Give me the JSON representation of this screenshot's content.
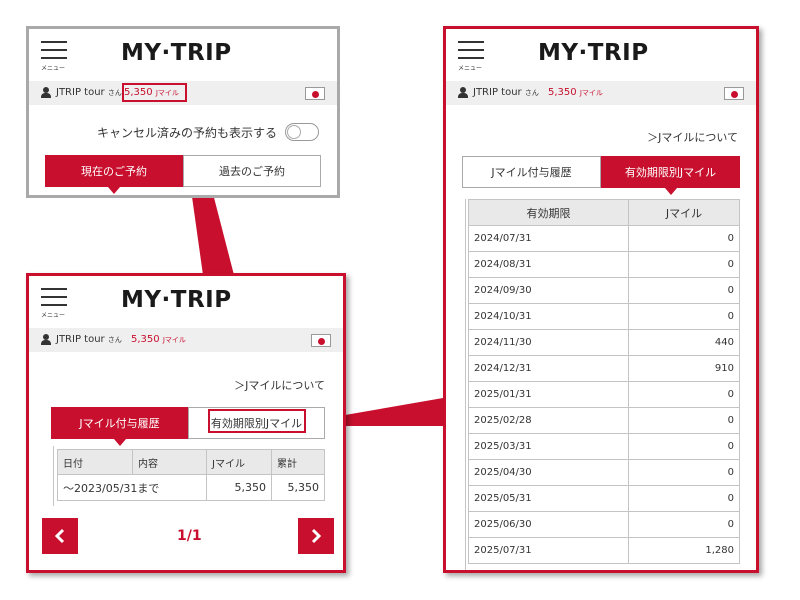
{
  "app": {
    "logo": "MY·TRIP",
    "menu_label": "メニュー"
  },
  "user": {
    "name": "JTRIP tour",
    "honorific": "さん",
    "miles_value": "5,350",
    "miles_unit": "Jマイル"
  },
  "reservations": {
    "toggle_label": "キャンセル済みの予約も表示する",
    "tab_current": "現在のご予約",
    "tab_past": "過去のご予約"
  },
  "jmiles": {
    "about_link": "＞Jマイルについて",
    "tab_history": "Jマイル付与履歴",
    "tab_expiry": "有効期限別Jマイル"
  },
  "history_table": {
    "headers": [
      "日付",
      "内容",
      "Jマイル",
      "累計"
    ],
    "rows": [
      [
        "～2023/05/31まで",
        "",
        "5,350",
        "5,350"
      ]
    ]
  },
  "pager": {
    "prev_icon": "chevron-left-icon",
    "next_icon": "chevron-right-icon",
    "page_text": "1/1"
  },
  "expiry_table": {
    "headers": [
      "有効期限",
      "Jマイル"
    ],
    "rows": [
      [
        "2024/07/31",
        "0"
      ],
      [
        "2024/08/31",
        "0"
      ],
      [
        "2024/09/30",
        "0"
      ],
      [
        "2024/10/31",
        "0"
      ],
      [
        "2024/11/30",
        "440"
      ],
      [
        "2024/12/31",
        "910"
      ],
      [
        "2025/01/31",
        "0"
      ],
      [
        "2025/02/28",
        "0"
      ],
      [
        "2025/03/31",
        "0"
      ],
      [
        "2025/04/30",
        "0"
      ],
      [
        "2025/05/31",
        "0"
      ],
      [
        "2025/06/30",
        "0"
      ],
      [
        "2025/07/31",
        "1,280"
      ]
    ]
  },
  "colors": {
    "accent": "#c8102e",
    "userbar_bg": "#efefef",
    "frame_gray": "#a9a9a9"
  }
}
